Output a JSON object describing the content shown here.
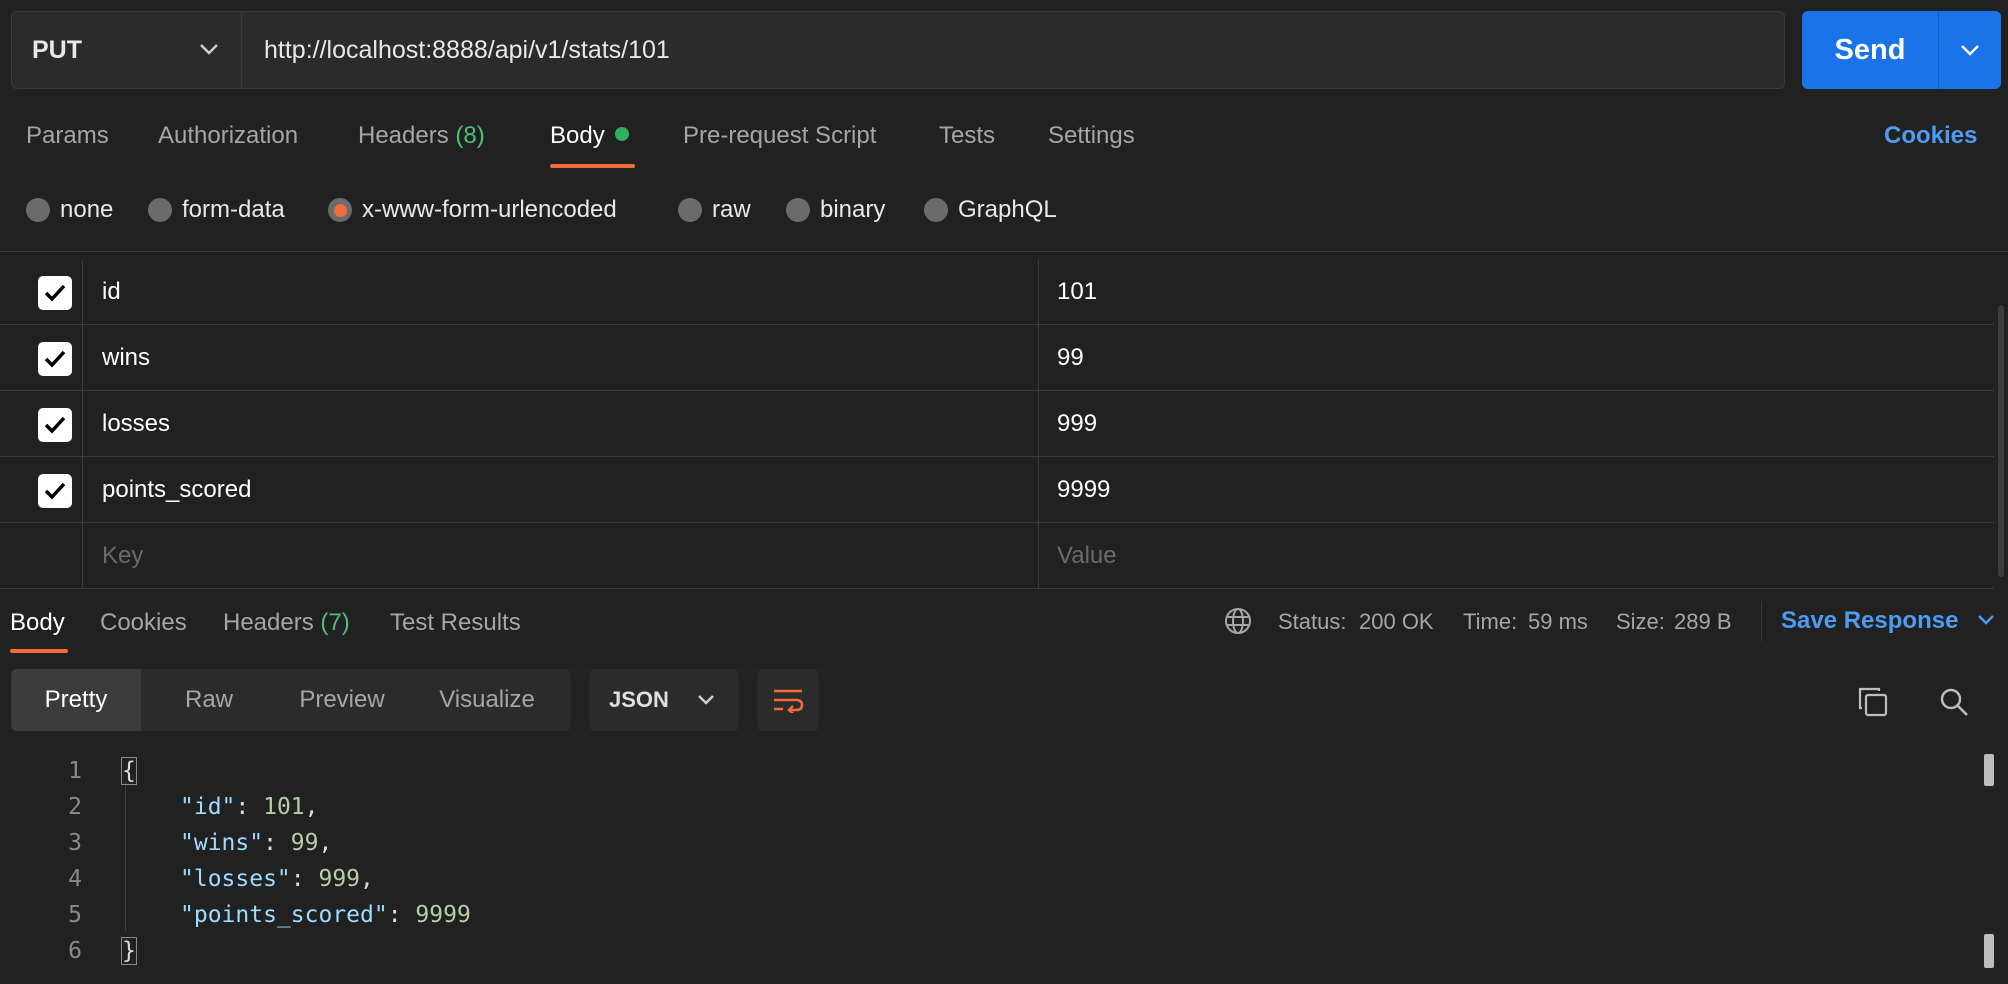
{
  "request": {
    "method": "PUT",
    "url": "http://localhost:8888/api/v1/stats/101",
    "send_label": "Send"
  },
  "request_tabs": {
    "params": "Params",
    "authorization": "Authorization",
    "headers": "Headers",
    "headers_count": "(8)",
    "body": "Body",
    "pre_request": "Pre-request Script",
    "tests": "Tests",
    "settings": "Settings",
    "cookies": "Cookies"
  },
  "body_types": {
    "none": "none",
    "form_data": "form-data",
    "urlencoded": "x-www-form-urlencoded",
    "raw": "raw",
    "binary": "binary",
    "graphql": "GraphQL",
    "selected": "x-www-form-urlencoded"
  },
  "params": [
    {
      "key": "id",
      "value": "101",
      "checked": true
    },
    {
      "key": "wins",
      "value": "99",
      "checked": true
    },
    {
      "key": "losses",
      "value": "999",
      "checked": true
    },
    {
      "key": "points_scored",
      "value": "9999",
      "checked": true
    }
  ],
  "new_row": {
    "key_placeholder": "Key",
    "value_placeholder": "Value"
  },
  "response": {
    "tabs": {
      "body": "Body",
      "cookies": "Cookies",
      "headers": "Headers",
      "headers_count": "(7)",
      "test_results": "Test Results"
    },
    "status_label": "Status:",
    "status_value": "200 OK",
    "time_label": "Time:",
    "time_value": "59 ms",
    "size_label": "Size:",
    "size_value": "289 B",
    "save_label": "Save Response",
    "view_modes": {
      "pretty": "Pretty",
      "raw": "Raw",
      "preview": "Preview",
      "visualize": "Visualize"
    },
    "format": "JSON",
    "line_numbers": [
      "1",
      "2",
      "3",
      "4",
      "5",
      "6"
    ],
    "json": {
      "open": "{",
      "close": "}",
      "lines": [
        {
          "key": "\"id\"",
          "value": "101",
          "comma": ","
        },
        {
          "key": "\"wins\"",
          "value": "99",
          "comma": ","
        },
        {
          "key": "\"losses\"",
          "value": "999",
          "comma": ","
        },
        {
          "key": "\"points_scored\"",
          "value": "9999",
          "comma": ""
        }
      ]
    }
  },
  "colors": {
    "accent_orange": "#f26b3a",
    "link_blue": "#4d9cf2",
    "send_blue": "#1a73e8",
    "status_green": "#4fbf77"
  }
}
